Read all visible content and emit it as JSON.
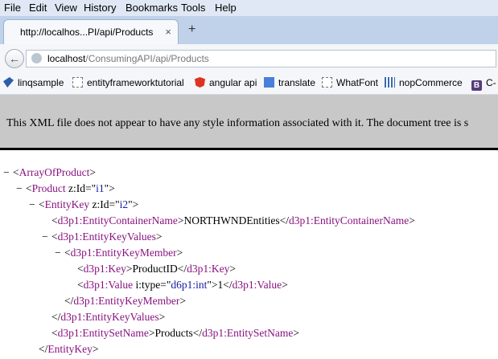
{
  "menu": [
    "File",
    "Edit",
    "View",
    "History",
    "Bookmarks",
    "Tools",
    "Help"
  ],
  "tab": {
    "title": "http://localhos...PI/api/Products",
    "close": "×",
    "new_tab": "+"
  },
  "nav": {
    "url_host": "localhost",
    "url_path": "/ConsumingAPI/api/Products"
  },
  "bookmarks": [
    "linqsample",
    "entityframeworktutorial",
    "angular api",
    "translate",
    "WhatFont",
    "nopCommerce",
    "C-"
  ],
  "infobar_text": "This XML file does not appear to have any style information associated with it. The document tree is s",
  "xml": {
    "fold_symbol": "−",
    "array_of_product": "ArrayOfProduct",
    "product": "Product",
    "entity_key": "EntityKey",
    "z_id_attr": "z:Id",
    "product_id_value": "i1",
    "entity_key_id_value": "i2",
    "container_name_tag": "d3p1:EntityContainerName",
    "container_name_value": "NORTHWNDEntities",
    "entity_key_values_tag": "d3p1:EntityKeyValues",
    "entity_key_member_tag": "d3p1:EntityKeyMember",
    "key_tag": "d3p1:Key",
    "key_value": "ProductID",
    "value_tag": "d3p1:Value",
    "type_attr": "i:type",
    "type_value": "d6p1:int",
    "value_value": "1",
    "entity_set_name_tag": "d3p1:EntitySetName",
    "entity_set_name_value": "Products"
  }
}
